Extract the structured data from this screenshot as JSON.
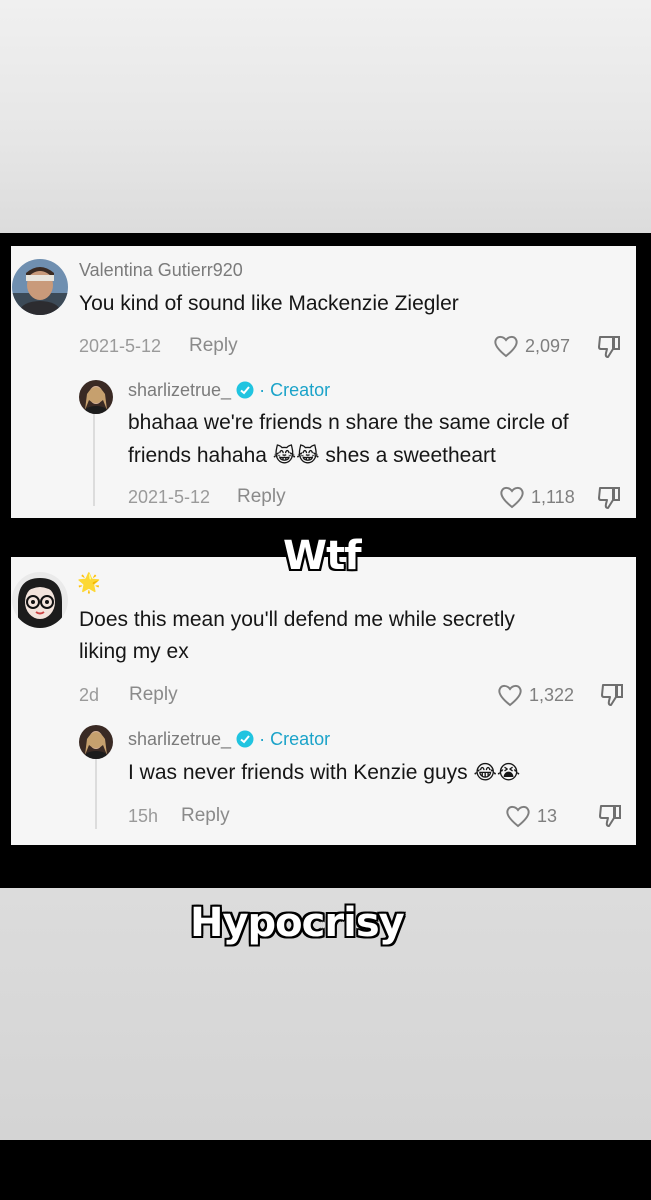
{
  "caption_top": "Wtf",
  "caption_bottom": "Hypocrisy",
  "thread1": {
    "comment": {
      "username": "Valentina Gutierr920",
      "text": "You kind of sound like Mackenzie Ziegler",
      "date": "2021-5-12",
      "reply_label": "Reply",
      "likes": "2,097"
    },
    "reply": {
      "username": "sharlizetrue_",
      "creator_label": "· Creator",
      "text_line1": "bhahaa we're friends n share the same circle of",
      "text_line2_pre": "friends hahaha",
      "emojis": "😹😹",
      "text_line2_post": "shes a sweetheart",
      "date": "2021-5-12",
      "reply_label": "Reply",
      "likes": "1,118"
    }
  },
  "thread2": {
    "comment": {
      "badge_emoji": "🌟",
      "text_line1": "Does this mean you'll defend me while secretly",
      "text_line2": "liking my ex",
      "date": "2d",
      "reply_label": "Reply",
      "likes": "1,322"
    },
    "reply": {
      "username": "sharlizetrue_",
      "creator_label": "· Creator",
      "text": "I was never friends with Kenzie guys",
      "emojis": "😂😭",
      "date": "15h",
      "reply_label": "Reply",
      "likes": "13"
    }
  },
  "colors": {
    "creator": "#1ba3c9",
    "card_bg": "#f6f6f6",
    "muted_text": "#9a9a9a"
  }
}
